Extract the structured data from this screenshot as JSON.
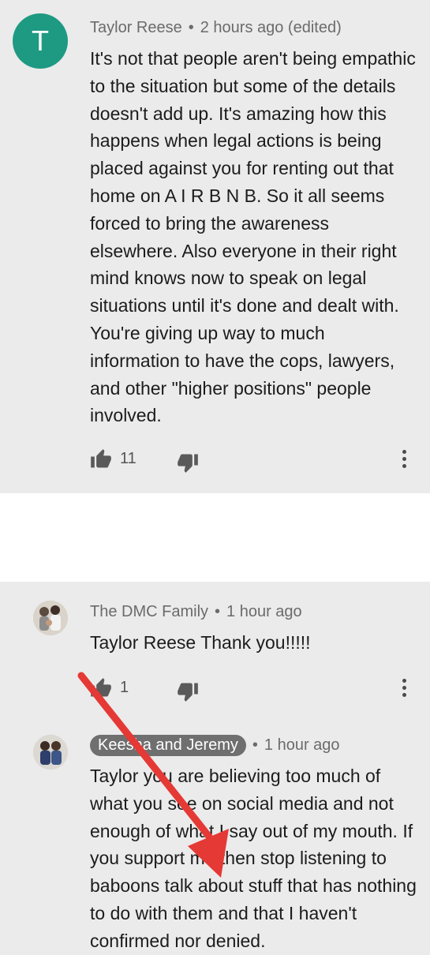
{
  "comments": [
    {
      "author": "Taylor Reese",
      "avatar_letter": "T",
      "time": "2 hours ago (edited)",
      "text": "It's not that people aren't being empathic to the situation but some of the details doesn't add up. It's amazing how this happens when legal actions is being placed against you for renting out that home on A I R B N B. So it all seems forced to bring the awareness elsewhere. Also everyone in their right mind knows now to speak on legal situations until it's done and dealt with. You're giving up way to much information to have the cops, lawyers, and other \"higher positions\" people involved.",
      "likes": "11"
    },
    {
      "author": "The DMC Family",
      "time": "1 hour ago",
      "text": "Taylor Reese Thank you!!!!!",
      "likes": "1"
    },
    {
      "author": "Keesha and Jeremy",
      "time": "1 hour ago",
      "text": "Taylor you are believing too much of what you see on social media and not enough of what I say out of my mouth. If you support me then stop listening to baboons talk about stuff that has nothing to do with them and that I haven't confirmed nor denied."
    }
  ],
  "ui": {
    "dot": "•",
    "accent_green": "#1e9a82",
    "arrow_color": "#e53935",
    "icons": [
      "thumbs-up-icon",
      "thumbs-down-icon",
      "more-vertical-icon"
    ]
  }
}
